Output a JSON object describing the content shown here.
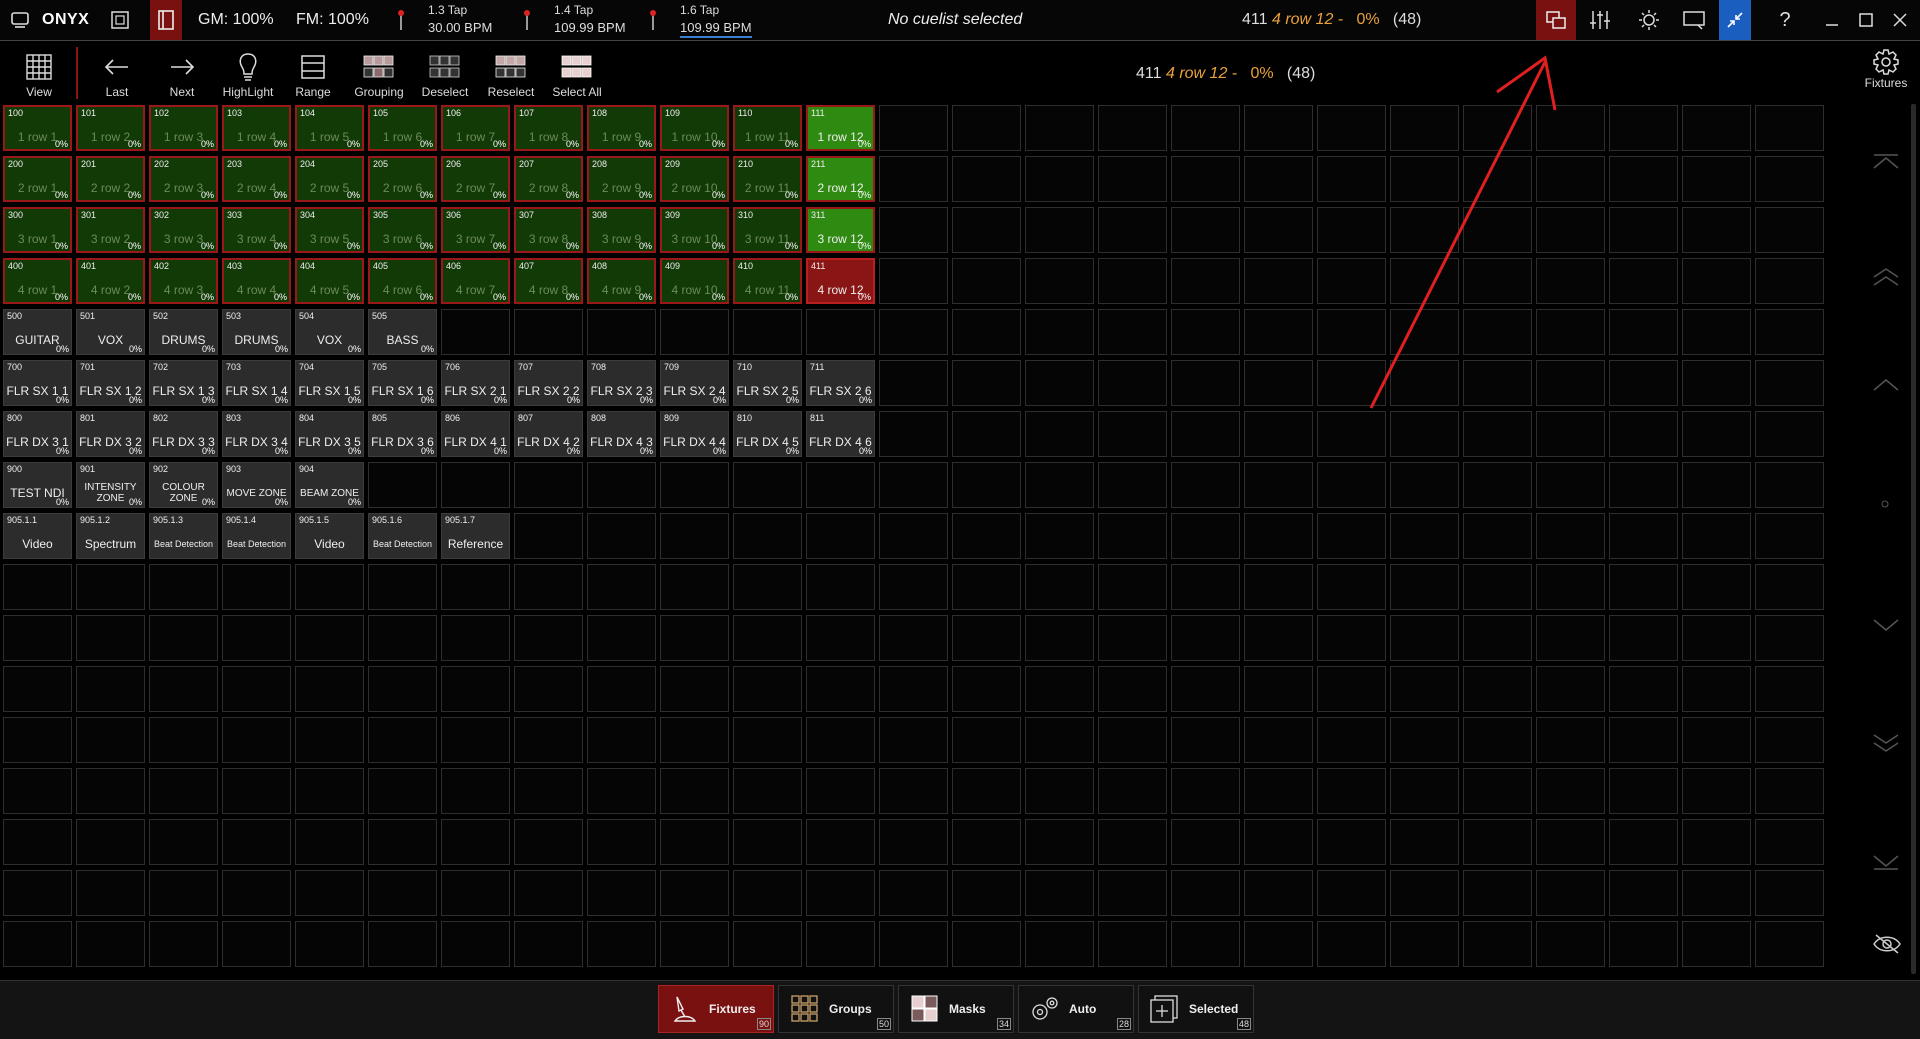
{
  "app": {
    "title": "ONYX"
  },
  "topbar": {
    "gm": "GM: 100%",
    "fm": "FM: 100%",
    "taps": [
      {
        "label": "1.3 Tap",
        "bpm": "30.00 BPM"
      },
      {
        "label": "1.4 Tap",
        "bpm": "109.99 BPM"
      },
      {
        "label": "1.6 Tap",
        "bpm": "109.99 BPM"
      }
    ],
    "cuelist": "No cuelist selected",
    "status": {
      "num": "411",
      "name": "4 row 12 -",
      "pct": "0%",
      "count": "(48)"
    }
  },
  "toolbar": {
    "view": "View",
    "last": "Last",
    "next": "Next",
    "highlight": "HighLight",
    "range": "Range",
    "grouping": "Grouping",
    "deselect": "Deselect",
    "reselect": "Reselect",
    "select_all": "Select All"
  },
  "selection": {
    "num": "411",
    "name": "4 row 12 -",
    "pct": "0%",
    "count": "(48)"
  },
  "right": {
    "fixtures": "Fixtures"
  },
  "grid": {
    "rows": [
      [
        {
          "n": "100",
          "l": "1 row 1",
          "p": "0%",
          "s": "g"
        },
        {
          "n": "101",
          "l": "1 row 2",
          "p": "0%",
          "s": "g"
        },
        {
          "n": "102",
          "l": "1 row 3",
          "p": "0%",
          "s": "g"
        },
        {
          "n": "103",
          "l": "1 row 4",
          "p": "0%",
          "s": "g"
        },
        {
          "n": "104",
          "l": "1 row 5",
          "p": "0%",
          "s": "g"
        },
        {
          "n": "105",
          "l": "1 row 6",
          "p": "0%",
          "s": "g"
        },
        {
          "n": "106",
          "l": "1 row 7",
          "p": "0%",
          "s": "g"
        },
        {
          "n": "107",
          "l": "1 row 8",
          "p": "0%",
          "s": "g"
        },
        {
          "n": "108",
          "l": "1 row 9",
          "p": "0%",
          "s": "g"
        },
        {
          "n": "109",
          "l": "1 row 10",
          "p": "0%",
          "s": "g"
        },
        {
          "n": "110",
          "l": "1 row 11",
          "p": "0%",
          "s": "g"
        },
        {
          "n": "111",
          "l": "1 row 12",
          "p": "0%",
          "s": "gb"
        }
      ],
      [
        {
          "n": "200",
          "l": "2 row 1",
          "p": "0%",
          "s": "g"
        },
        {
          "n": "201",
          "l": "2 row 2",
          "p": "0%",
          "s": "g"
        },
        {
          "n": "202",
          "l": "2 row 3",
          "p": "0%",
          "s": "g"
        },
        {
          "n": "203",
          "l": "2 row 4",
          "p": "0%",
          "s": "g"
        },
        {
          "n": "204",
          "l": "2 row 5",
          "p": "0%",
          "s": "g"
        },
        {
          "n": "205",
          "l": "2 row 6",
          "p": "0%",
          "s": "g"
        },
        {
          "n": "206",
          "l": "2 row 7",
          "p": "0%",
          "s": "g"
        },
        {
          "n": "207",
          "l": "2 row 8",
          "p": "0%",
          "s": "g"
        },
        {
          "n": "208",
          "l": "2 row 9",
          "p": "0%",
          "s": "g"
        },
        {
          "n": "209",
          "l": "2 row 10",
          "p": "0%",
          "s": "g"
        },
        {
          "n": "210",
          "l": "2 row 11",
          "p": "0%",
          "s": "g"
        },
        {
          "n": "211",
          "l": "2 row 12",
          "p": "0%",
          "s": "gb"
        }
      ],
      [
        {
          "n": "300",
          "l": "3 row 1",
          "p": "0%",
          "s": "g"
        },
        {
          "n": "301",
          "l": "3 row 2",
          "p": "0%",
          "s": "g"
        },
        {
          "n": "302",
          "l": "3 row 3",
          "p": "0%",
          "s": "g"
        },
        {
          "n": "303",
          "l": "3 row 4",
          "p": "0%",
          "s": "g"
        },
        {
          "n": "304",
          "l": "3 row 5",
          "p": "0%",
          "s": "g"
        },
        {
          "n": "305",
          "l": "3 row 6",
          "p": "0%",
          "s": "g"
        },
        {
          "n": "306",
          "l": "3 row 7",
          "p": "0%",
          "s": "g"
        },
        {
          "n": "307",
          "l": "3 row 8",
          "p": "0%",
          "s": "g"
        },
        {
          "n": "308",
          "l": "3 row 9",
          "p": "0%",
          "s": "g"
        },
        {
          "n": "309",
          "l": "3 row 10",
          "p": "0%",
          "s": "g"
        },
        {
          "n": "310",
          "l": "3 row 11",
          "p": "0%",
          "s": "g"
        },
        {
          "n": "311",
          "l": "3 row 12",
          "p": "0%",
          "s": "gb"
        }
      ],
      [
        {
          "n": "400",
          "l": "4 row 1",
          "p": "0%",
          "s": "g"
        },
        {
          "n": "401",
          "l": "4 row 2",
          "p": "0%",
          "s": "g"
        },
        {
          "n": "402",
          "l": "4 row 3",
          "p": "0%",
          "s": "g"
        },
        {
          "n": "403",
          "l": "4 row 4",
          "p": "0%",
          "s": "g"
        },
        {
          "n": "404",
          "l": "4 row 5",
          "p": "0%",
          "s": "g"
        },
        {
          "n": "405",
          "l": "4 row 6",
          "p": "0%",
          "s": "g"
        },
        {
          "n": "406",
          "l": "4 row 7",
          "p": "0%",
          "s": "g"
        },
        {
          "n": "407",
          "l": "4 row 8",
          "p": "0%",
          "s": "g"
        },
        {
          "n": "408",
          "l": "4 row 9",
          "p": "0%",
          "s": "g"
        },
        {
          "n": "409",
          "l": "4 row 10",
          "p": "0%",
          "s": "g"
        },
        {
          "n": "410",
          "l": "4 row 11",
          "p": "0%",
          "s": "g"
        },
        {
          "n": "411",
          "l": "4 row 12",
          "p": "0%",
          "s": "r"
        }
      ],
      [
        {
          "n": "500",
          "l": "GUITAR",
          "p": "0%",
          "s": "f"
        },
        {
          "n": "501",
          "l": "VOX",
          "p": "0%",
          "s": "f"
        },
        {
          "n": "502",
          "l": "DRUMS",
          "p": "0%",
          "s": "f"
        },
        {
          "n": "503",
          "l": "DRUMS",
          "p": "0%",
          "s": "f"
        },
        {
          "n": "504",
          "l": "VOX",
          "p": "0%",
          "s": "f"
        },
        {
          "n": "505",
          "l": "BASS",
          "p": "0%",
          "s": "f"
        }
      ],
      [
        {
          "n": "700",
          "l": "FLR SX 1 1",
          "p": "0%",
          "s": "f"
        },
        {
          "n": "701",
          "l": "FLR SX 1 2",
          "p": "0%",
          "s": "f"
        },
        {
          "n": "702",
          "l": "FLR SX 1 3",
          "p": "0%",
          "s": "f"
        },
        {
          "n": "703",
          "l": "FLR SX 1 4",
          "p": "0%",
          "s": "f"
        },
        {
          "n": "704",
          "l": "FLR SX 1 5",
          "p": "0%",
          "s": "f"
        },
        {
          "n": "705",
          "l": "FLR SX 1 6",
          "p": "0%",
          "s": "f"
        },
        {
          "n": "706",
          "l": "FLR SX 2 1",
          "p": "0%",
          "s": "f"
        },
        {
          "n": "707",
          "l": "FLR SX 2 2",
          "p": "0%",
          "s": "f"
        },
        {
          "n": "708",
          "l": "FLR SX 2 3",
          "p": "0%",
          "s": "f"
        },
        {
          "n": "709",
          "l": "FLR SX 2 4",
          "p": "0%",
          "s": "f"
        },
        {
          "n": "710",
          "l": "FLR SX 2 5",
          "p": "0%",
          "s": "f"
        },
        {
          "n": "711",
          "l": "FLR SX 2 6",
          "p": "0%",
          "s": "f"
        }
      ],
      [
        {
          "n": "800",
          "l": "FLR DX 3 1",
          "p": "0%",
          "s": "f"
        },
        {
          "n": "801",
          "l": "FLR DX 3 2",
          "p": "0%",
          "s": "f"
        },
        {
          "n": "802",
          "l": "FLR DX 3 3",
          "p": "0%",
          "s": "f"
        },
        {
          "n": "803",
          "l": "FLR DX 3 4",
          "p": "0%",
          "s": "f"
        },
        {
          "n": "804",
          "l": "FLR DX 3 5",
          "p": "0%",
          "s": "f"
        },
        {
          "n": "805",
          "l": "FLR DX 3 6",
          "p": "0%",
          "s": "f"
        },
        {
          "n": "806",
          "l": "FLR DX 4 1",
          "p": "0%",
          "s": "f"
        },
        {
          "n": "807",
          "l": "FLR DX 4 2",
          "p": "0%",
          "s": "f"
        },
        {
          "n": "808",
          "l": "FLR DX 4 3",
          "p": "0%",
          "s": "f"
        },
        {
          "n": "809",
          "l": "FLR DX 4 4",
          "p": "0%",
          "s": "f"
        },
        {
          "n": "810",
          "l": "FLR DX 4 5",
          "p": "0%",
          "s": "f"
        },
        {
          "n": "811",
          "l": "FLR DX 4 6",
          "p": "0%",
          "s": "f"
        }
      ],
      [
        {
          "n": "900",
          "l": "TEST NDI",
          "p": "0%",
          "s": "f"
        },
        {
          "n": "901",
          "l": "INTENSITY ZONE",
          "p": "0%",
          "s": "f",
          "sm": 1
        },
        {
          "n": "902",
          "l": "COLOUR ZONE",
          "p": "0%",
          "s": "f",
          "sm": 1
        },
        {
          "n": "903",
          "l": "MOVE ZONE",
          "p": "0%",
          "s": "f",
          "sm": 1
        },
        {
          "n": "904",
          "l": "BEAM ZONE",
          "p": "0%",
          "s": "f",
          "sm": 1
        }
      ],
      [
        {
          "n": "905.1.1",
          "l": "Video",
          "p": "",
          "s": "f"
        },
        {
          "n": "905.1.2",
          "l": "Spectrum",
          "p": "",
          "s": "f"
        },
        {
          "n": "905.1.3",
          "l": "Beat Detection",
          "p": "",
          "s": "f",
          "xs": 1
        },
        {
          "n": "905.1.4",
          "l": "Beat Detection",
          "p": "",
          "s": "f",
          "xs": 1
        },
        {
          "n": "905.1.5",
          "l": "Video",
          "p": "",
          "s": "f"
        },
        {
          "n": "905.1.6",
          "l": "Beat Detection",
          "p": "",
          "s": "f",
          "xs": 1
        },
        {
          "n": "905.1.7",
          "l": "Reference",
          "p": "",
          "s": "f"
        }
      ]
    ]
  },
  "tabs": [
    {
      "label": "Fixtures",
      "count": "90",
      "icon": "fixture-icon",
      "active": true
    },
    {
      "label": "Groups",
      "count": "50",
      "icon": "groups-icon"
    },
    {
      "label": "Masks",
      "count": "34",
      "icon": "masks-icon"
    },
    {
      "label": "Auto",
      "count": "28",
      "icon": "auto-icon"
    },
    {
      "label": "Selected",
      "count": "48",
      "icon": "selected-icon"
    }
  ],
  "colors": {
    "accent_red": "#8a1515",
    "green": "#123a07",
    "bright_green": "#2f8a12",
    "orange": "#e9a23b",
    "blue": "#1a5fbf"
  }
}
